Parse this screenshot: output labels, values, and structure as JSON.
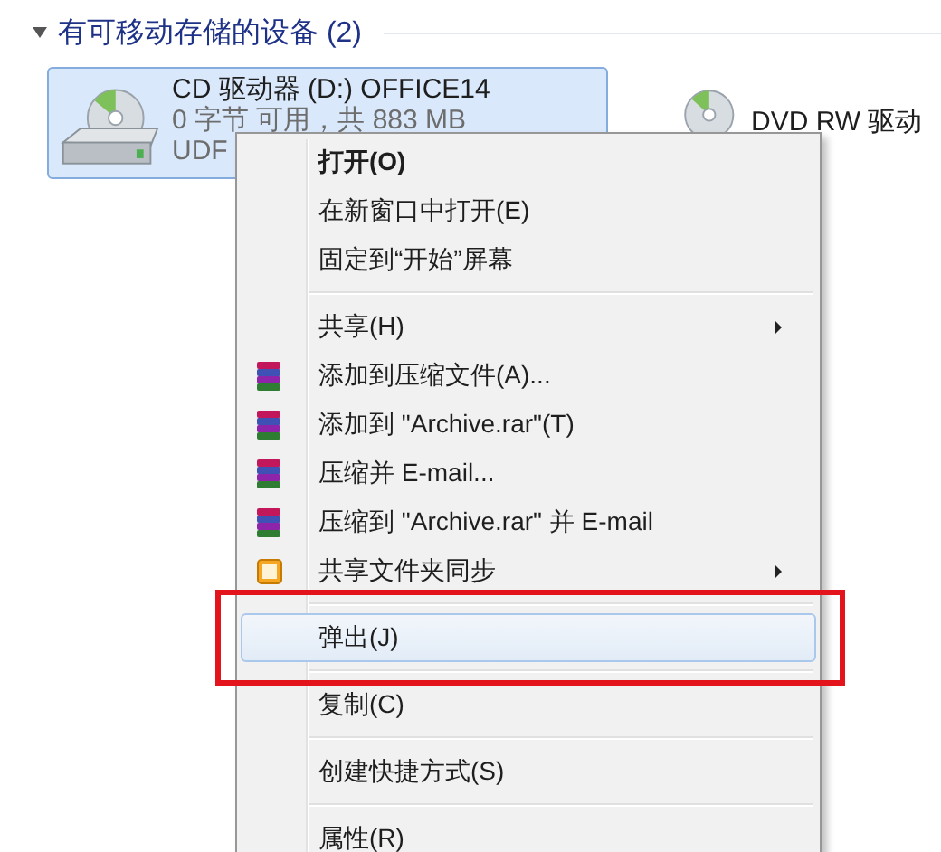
{
  "group": {
    "title": "有可移动存储的设备 (2)",
    "expanded": true
  },
  "drives": [
    {
      "kind": "cd",
      "name": "CD 驱动器 (D:) OFFICE14",
      "details": [
        "0 字节 可用，共 883 MB",
        "UDF"
      ],
      "selected": true
    },
    {
      "kind": "dvd",
      "name": "DVD RW 驱动",
      "selected": false
    }
  ],
  "context_menu": [
    {
      "kind": "item",
      "label": "打开(O)",
      "bold": true,
      "submenu": false,
      "selected": false,
      "annotated": false
    },
    {
      "kind": "item",
      "label": "在新窗口中打开(E)",
      "bold": false,
      "submenu": false,
      "selected": false,
      "annotated": false
    },
    {
      "kind": "item",
      "label": "固定到“开始”屏幕",
      "bold": false,
      "submenu": false,
      "selected": false,
      "annotated": false
    },
    {
      "kind": "separator"
    },
    {
      "kind": "item",
      "label": "共享(H)",
      "bold": false,
      "submenu": true,
      "selected": false,
      "annotated": false
    },
    {
      "kind": "archive",
      "label": "添加到压缩文件(A)...",
      "bold": false,
      "submenu": false,
      "selected": false,
      "annotated": false
    },
    {
      "kind": "archive",
      "label": "添加到 \"Archive.rar\"(T)",
      "bold": false,
      "submenu": false,
      "selected": false,
      "annotated": false
    },
    {
      "kind": "archive",
      "label": "压缩并 E-mail...",
      "bold": false,
      "submenu": false,
      "selected": false,
      "annotated": false
    },
    {
      "kind": "archive",
      "label": "压缩到 \"Archive.rar\" 并 E-mail",
      "bold": false,
      "submenu": false,
      "selected": false,
      "annotated": false
    },
    {
      "kind": "sync",
      "label": "共享文件夹同步",
      "bold": false,
      "submenu": true,
      "selected": false,
      "annotated": false
    },
    {
      "kind": "separator"
    },
    {
      "kind": "item",
      "label": "弹出(J)",
      "bold": false,
      "submenu": false,
      "selected": true,
      "annotated": true
    },
    {
      "kind": "separator"
    },
    {
      "kind": "item",
      "label": "复制(C)",
      "bold": false,
      "submenu": false,
      "selected": false,
      "annotated": false
    },
    {
      "kind": "separator"
    },
    {
      "kind": "item",
      "label": "创建快捷方式(S)",
      "bold": false,
      "submenu": false,
      "selected": false,
      "annotated": false
    },
    {
      "kind": "separator"
    },
    {
      "kind": "item",
      "label": "属性(R)",
      "bold": false,
      "submenu": false,
      "selected": false,
      "annotated": false
    }
  ]
}
